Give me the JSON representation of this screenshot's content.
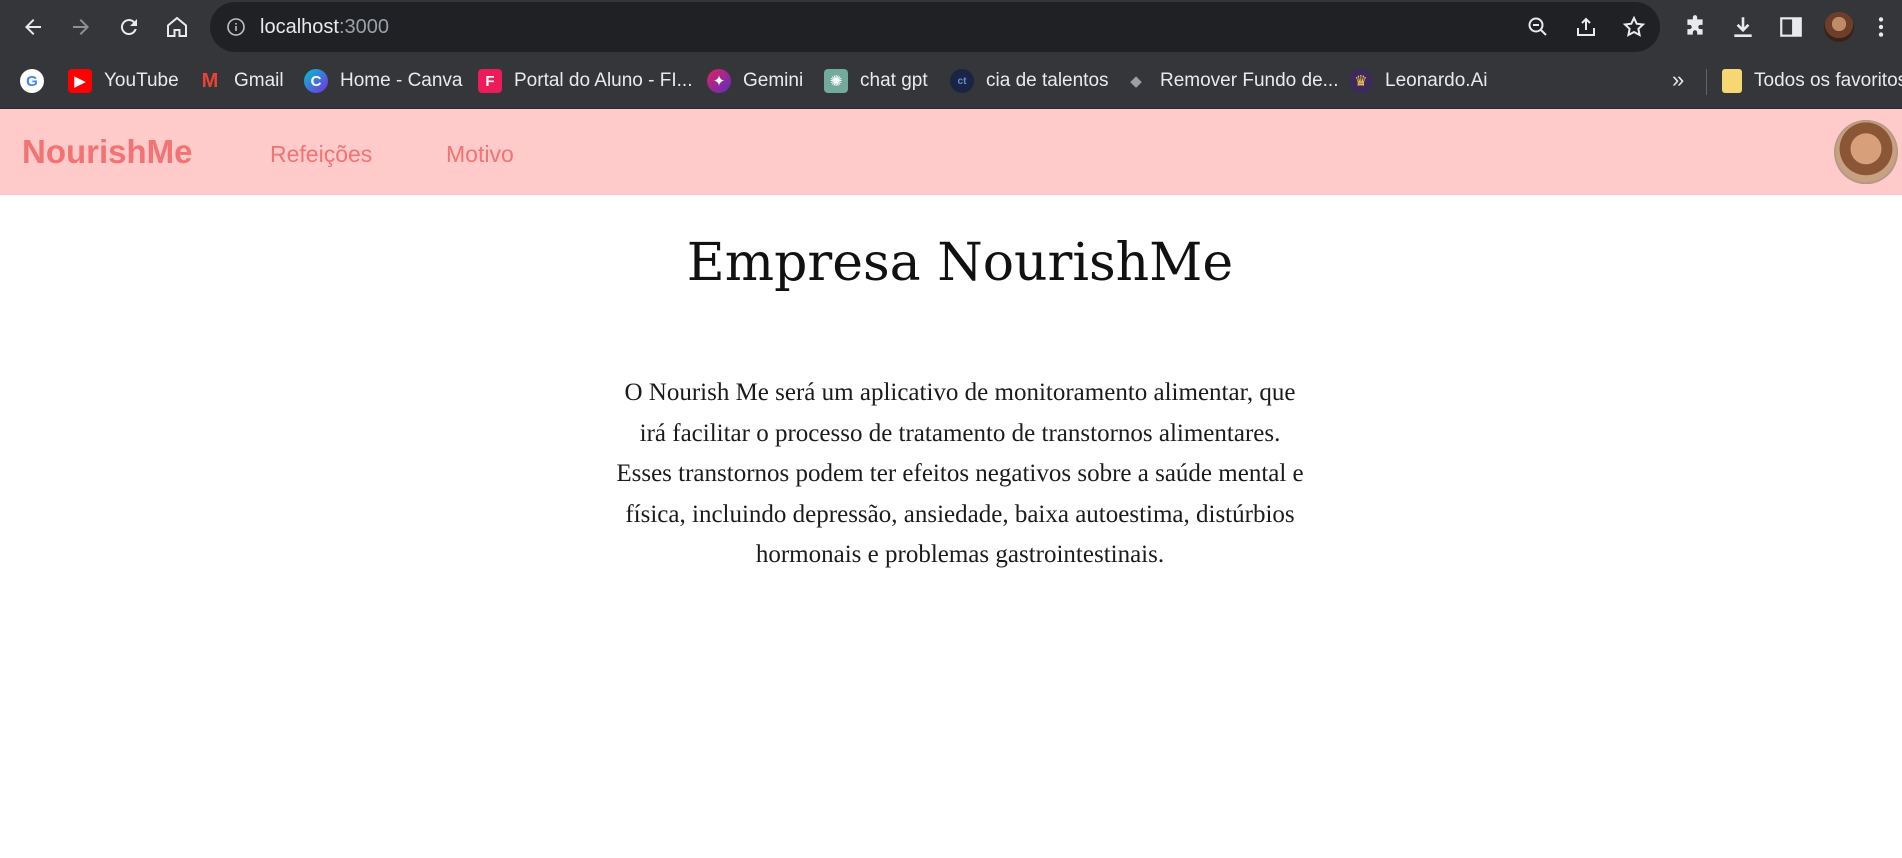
{
  "browser": {
    "url_host": "localhost",
    "url_port": ":3000",
    "bookmarks": [
      {
        "label": "",
        "icon": "google-icon"
      },
      {
        "label": "YouTube",
        "icon": "youtube-icon"
      },
      {
        "label": "Gmail",
        "icon": "gmail-icon"
      },
      {
        "label": "Home - Canva",
        "icon": "canva-icon"
      },
      {
        "label": "Portal do Aluno - FI...",
        "icon": "portal-icon"
      },
      {
        "label": "Gemini",
        "icon": "gemini-icon"
      },
      {
        "label": "chat gpt",
        "icon": "chatgpt-icon"
      },
      {
        "label": "cia de talentos",
        "icon": "cia-icon"
      },
      {
        "label": "Remover Fundo de...",
        "icon": "remove-bg-icon"
      },
      {
        "label": "Leonardo.Ai",
        "icon": "leonardo-icon"
      }
    ],
    "more_label": "»",
    "all_bookmarks_label": "Todos os favoritos"
  },
  "app": {
    "brand": "NourishMe",
    "nav": [
      "Refeições",
      "Motivo"
    ],
    "colors": {
      "nav_bg": "#ffcaca",
      "accent": "#f27373"
    }
  },
  "main": {
    "title": "Empresa NourishMe",
    "paragraph": "O Nourish Me será um aplicativo de monitoramento alimentar, que irá facilitar o processo de tratamento de transtornos alimentares. Esses transtornos podem ter efeitos negativos sobre a saúde mental e física, incluindo depressão, ansiedade, baixa autoestima, distúrbios hormonais e problemas gastrointestinais."
  }
}
